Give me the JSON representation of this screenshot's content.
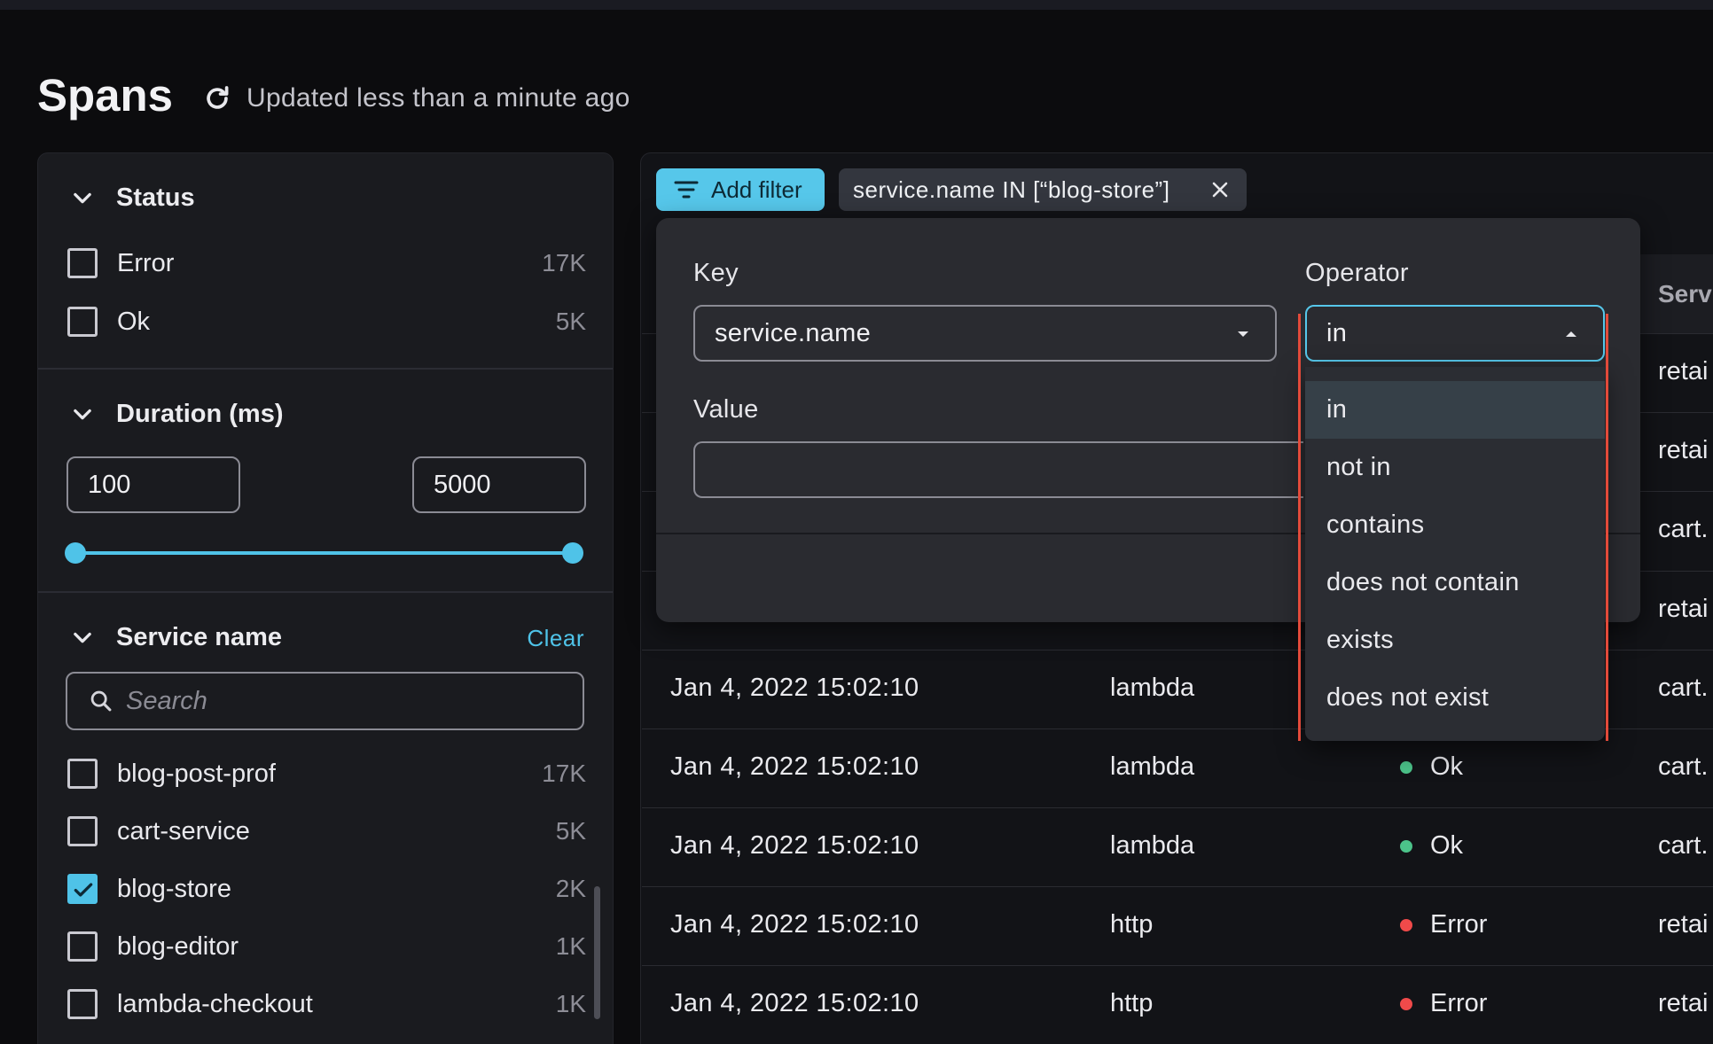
{
  "page": {
    "title": "Spans",
    "updated": "Updated less than a minute ago"
  },
  "sidebar": {
    "status": {
      "title": "Status",
      "items": [
        {
          "label": "Error",
          "count": "17K"
        },
        {
          "label": "Ok",
          "count": "5K"
        }
      ]
    },
    "duration": {
      "title": "Duration (ms)",
      "min": "100",
      "max": "5000"
    },
    "service": {
      "title": "Service name",
      "clear": "Clear",
      "search_placeholder": "Search",
      "items": [
        {
          "label": "blog-post-prof",
          "count": "17K",
          "checked": false
        },
        {
          "label": "cart-service",
          "count": "5K",
          "checked": false
        },
        {
          "label": "blog-store",
          "count": "2K",
          "checked": true
        },
        {
          "label": "blog-editor",
          "count": "1K",
          "checked": false
        },
        {
          "label": "lambda-checkout",
          "count": "1K",
          "checked": false
        }
      ]
    }
  },
  "filters": {
    "add_label": "Add filter",
    "chip": "service.name IN [“blog-store”]"
  },
  "table": {
    "service_header": "Serv",
    "rows": [
      {
        "date": "",
        "type": "",
        "status": "",
        "status_kind": "",
        "service": "retai"
      },
      {
        "date": "",
        "type": "",
        "status": "",
        "status_kind": "",
        "service": "retai"
      },
      {
        "date": "",
        "type": "",
        "status": "",
        "status_kind": "",
        "service": "cart."
      },
      {
        "date": "",
        "type": "",
        "status": "",
        "status_kind": "",
        "service": "retai"
      },
      {
        "date": "Jan 4, 2022  15:02:10",
        "type": "lambda",
        "status": "",
        "status_kind": "",
        "service": "cart."
      },
      {
        "date": "Jan 4, 2022  15:02:10",
        "type": "lambda",
        "status": "Ok",
        "status_kind": "ok",
        "service": "cart."
      },
      {
        "date": "Jan 4, 2022  15:02:10",
        "type": "lambda",
        "status": "Ok",
        "status_kind": "ok",
        "service": "cart."
      },
      {
        "date": "Jan 4, 2022  15:02:10",
        "type": "http",
        "status": "Error",
        "status_kind": "err",
        "service": "retai"
      },
      {
        "date": "Jan 4, 2022  15:02:10",
        "type": "http",
        "status": "Error",
        "status_kind": "err",
        "service": "retai"
      }
    ]
  },
  "popover": {
    "key_label": "Key",
    "key_value": "service.name",
    "operator_label": "Operator",
    "operator_value": "in",
    "value_label": "Value",
    "operators": [
      "in",
      "not in",
      "contains",
      "does not contain",
      "exists",
      "does not exist"
    ],
    "selected_operator_index": 0
  },
  "colors": {
    "accent": "#56c7ea",
    "ok": "#4cc38a",
    "error": "#f04a4a",
    "guide": "#e24a3a"
  }
}
